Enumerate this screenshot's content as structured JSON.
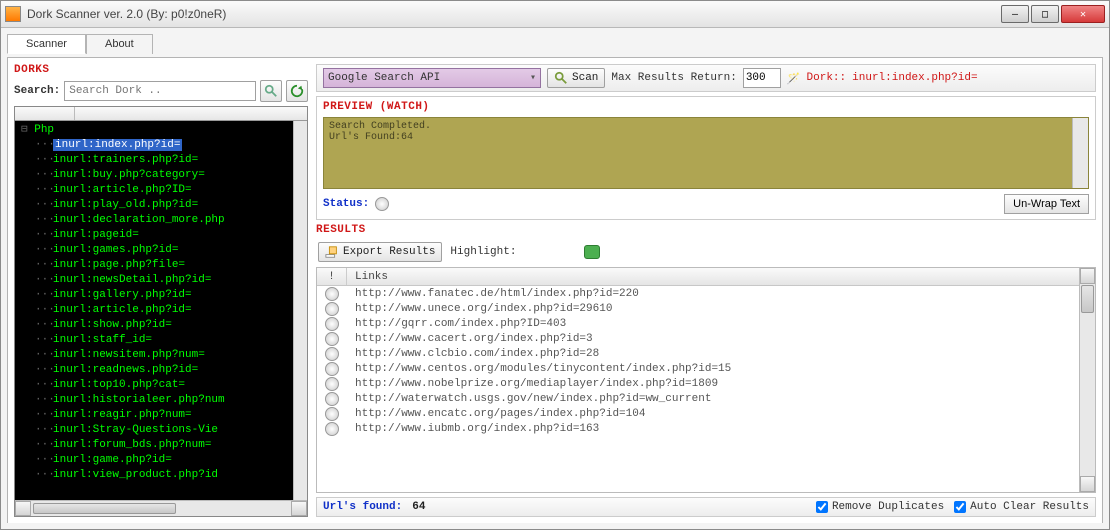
{
  "window": {
    "title": "Dork Scanner ver. 2.0 (By: p0!z0neR)"
  },
  "tabs": [
    {
      "label": "Scanner",
      "active": true
    },
    {
      "label": "About",
      "active": false
    }
  ],
  "dorks": {
    "title": "DORKS",
    "search_label": "Search:",
    "search_placeholder": "Search Dork ..",
    "root": "Php",
    "selected": "inurl:index.php?id=",
    "items": [
      "inurl:index.php?id=",
      "inurl:trainers.php?id=",
      "inurl:buy.php?category=",
      "inurl:article.php?ID=",
      "inurl:play_old.php?id=",
      "inurl:declaration_more.php",
      "inurl:pageid=",
      "inurl:games.php?id=",
      "inurl:page.php?file=",
      "inurl:newsDetail.php?id=",
      "inurl:gallery.php?id=",
      "inurl:article.php?id=",
      "inurl:show.php?id=",
      "inurl:staff_id=",
      "inurl:newsitem.php?num=",
      "inurl:readnews.php?id=",
      "inurl:top10.php?cat=",
      "inurl:historialeer.php?num",
      "inurl:reagir.php?num=",
      "inurl:Stray-Questions-Vie",
      "inurl:forum_bds.php?num=",
      "inurl:game.php?id=",
      "inurl:view_product.php?id"
    ]
  },
  "scan": {
    "api_combo": "Google Search API",
    "scan_btn": "Scan",
    "max_label": "Max Results Return:",
    "max_value": "300",
    "dork_prefix": "Dork::",
    "dork_value": "inurl:index.php?id="
  },
  "preview": {
    "title": "PREVIEW (WATCH)",
    "line1": "Search Completed.",
    "line2": "Url's Found:64",
    "status_label": "Status:",
    "unwrap_btn": "Un-Wrap Text"
  },
  "results": {
    "title": "RESULTS",
    "export_btn": "Export Results",
    "highlight_label": "Highlight:",
    "header_col1": "!",
    "header_col2": "Links",
    "rows": [
      "http://www.fanatec.de/html/index.php?id=220",
      "http://www.unece.org/index.php?id=29610",
      "http://gqrr.com/index.php?ID=403",
      "http://www.cacert.org/index.php?id=3",
      "http://www.clcbio.com/index.php?id=28",
      "http://www.centos.org/modules/tinycontent/index.php?id=15",
      "http://www.nobelprize.org/mediaplayer/index.php?id=1809",
      "http://waterwatch.usgs.gov/new/index.php?id=ww_current",
      "http://www.encatc.org/pages/index.php?id=104",
      "http://www.iubmb.org/index.php?id=163"
    ]
  },
  "footer": {
    "found_label": "Url's found:",
    "found_count": "64",
    "remove_dup": "Remove Duplicates",
    "auto_clear": "Auto Clear Results"
  }
}
